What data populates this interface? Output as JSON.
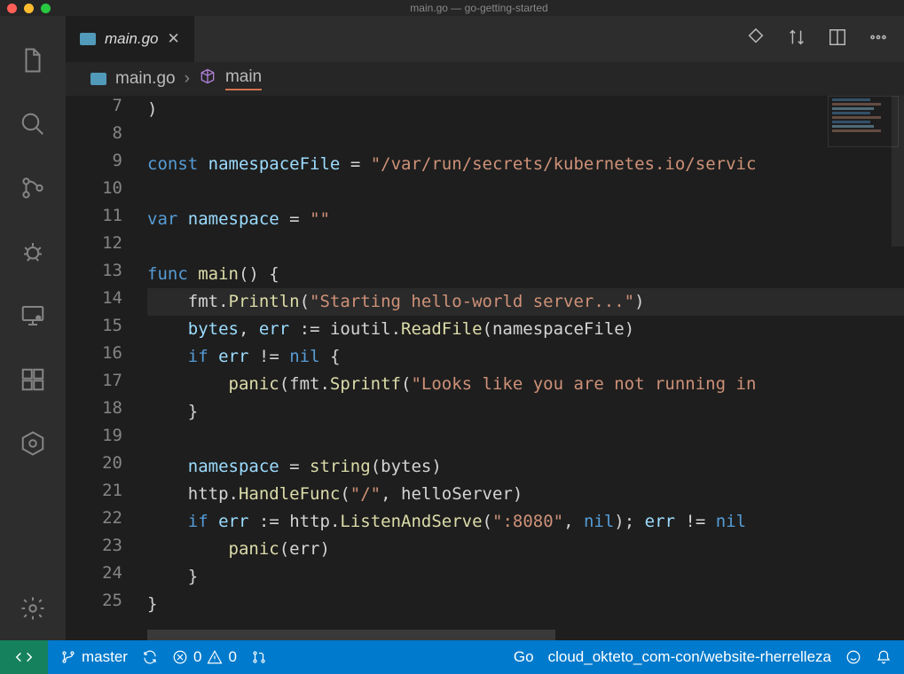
{
  "window_title": "main.go — go-getting-started",
  "tab": {
    "filename": "main.go"
  },
  "breadcrumb": {
    "file": "main.go",
    "symbol": "main"
  },
  "code_lines": [
    {
      "n": 7,
      "html": ")"
    },
    {
      "n": 8,
      "html": ""
    },
    {
      "n": 9,
      "html": "<span class='kw'>const</span> <span class='id'>namespaceFile</span> = <span class='str'>\"/var/run/secrets/kubernetes.io/servic</span>"
    },
    {
      "n": 10,
      "html": ""
    },
    {
      "n": 11,
      "html": "<span class='kw'>var</span> <span class='id'>namespace</span> = <span class='str'>\"\"</span>"
    },
    {
      "n": 12,
      "html": ""
    },
    {
      "n": 13,
      "html": "<span class='kw'>func</span> <span class='fn'>main</span>() {"
    },
    {
      "n": 14,
      "html": "    fmt.<span class='fn'>Println</span>(<span class='str'>\"Starting hello-world server...\"</span>)",
      "hl": true
    },
    {
      "n": 15,
      "html": "    <span class='id'>bytes</span>, <span class='id'>err</span> := ioutil.<span class='fn'>ReadFile</span>(namespaceFile)"
    },
    {
      "n": 16,
      "html": "    <span class='kw'>if</span> <span class='id'>err</span> != <span class='nilkw'>nil</span> {"
    },
    {
      "n": 17,
      "html": "        <span class='fn'>panic</span>(fmt.<span class='fn'>Sprintf</span>(<span class='str'>\"Looks like you are not running in</span>"
    },
    {
      "n": 18,
      "html": "    }"
    },
    {
      "n": 19,
      "html": ""
    },
    {
      "n": 20,
      "html": "    <span class='id'>namespace</span> = <span class='fn'>string</span>(bytes)"
    },
    {
      "n": 21,
      "html": "    http.<span class='fn'>HandleFunc</span>(<span class='str'>\"/\"</span>, helloServer)"
    },
    {
      "n": 22,
      "html": "    <span class='kw'>if</span> <span class='id'>err</span> := http.<span class='fn'>ListenAndServe</span>(<span class='str'>\":8080\"</span>, <span class='nilkw'>nil</span>); <span class='id'>err</span> != <span class='nilkw'>nil</span>"
    },
    {
      "n": 23,
      "html": "        <span class='fn'>panic</span>(err)"
    },
    {
      "n": 24,
      "html": "    }"
    },
    {
      "n": 25,
      "html": "}"
    }
  ],
  "status": {
    "branch": "master",
    "errors": "0",
    "warnings": "0",
    "language": "Go",
    "context": "cloud_okteto_com-con/website-rherrelleza"
  }
}
